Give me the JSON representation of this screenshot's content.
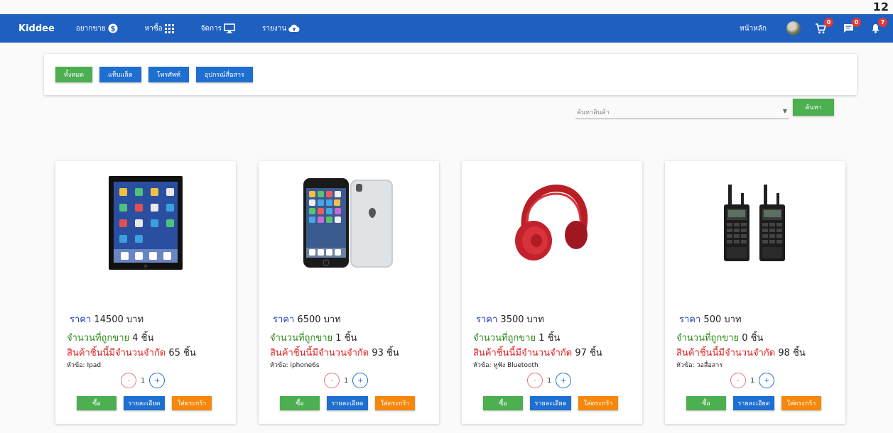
{
  "corner_number": "12",
  "nav": {
    "brand": "Kiddee",
    "items": [
      {
        "label": "อยากขาย",
        "icon": "dollar-circle-icon"
      },
      {
        "label": "หาซื้อ",
        "icon": "grid-icon"
      },
      {
        "label": "จัดการ",
        "icon": "monitor-icon"
      },
      {
        "label": "รายงาน",
        "icon": "cloud-upload-icon"
      }
    ],
    "home_label": "หน้าหลัก",
    "cart_badge": "0",
    "message_badge": "0",
    "notification_badge": "7"
  },
  "filters": {
    "all": "ทั้งหมด",
    "tablet": "แท็บแล็ต",
    "phone": "โทรศัพท์",
    "accessory": "อุปกรณ์สื่อสาร"
  },
  "search": {
    "placeholder": "ค้นหาสินค้า",
    "button_label": "ค้นหา"
  },
  "labels": {
    "price_prefix": "ราคา",
    "currency": "บาท",
    "sold_prefix": "จำนวนที่ถูกขาย",
    "limit_prefix": "สินค้าชิ้นนี้มีจำนวนจำกัด",
    "unit": "ชิ้น",
    "title_prefix": "หัวข้อ:",
    "minus": "-",
    "plus": "+",
    "buy": "ซื้อ",
    "detail": "รายละเอียด",
    "add_cart": "ใส่ตระกร้า"
  },
  "products": [
    {
      "price": "14500",
      "sold": "4",
      "limit": "65",
      "title": "Ipad",
      "qty": "1",
      "image": "tablet"
    },
    {
      "price": "6500",
      "sold": "1",
      "limit": "93",
      "title": "iphone6s",
      "qty": "1",
      "image": "phone"
    },
    {
      "price": "3500",
      "sold": "1",
      "limit": "97",
      "title": "หูฟัง Bluetooth",
      "qty": "1",
      "image": "headphones"
    },
    {
      "price": "500",
      "sold": "0",
      "limit": "98",
      "title": "วอสื่อสาร",
      "qty": "1",
      "image": "walkie-talkie"
    }
  ],
  "colors": {
    "navbar": "#1e5fbf",
    "green": "#4caf50",
    "blue": "#1e6fd0",
    "orange": "#f5880c",
    "red": "#e02020"
  }
}
